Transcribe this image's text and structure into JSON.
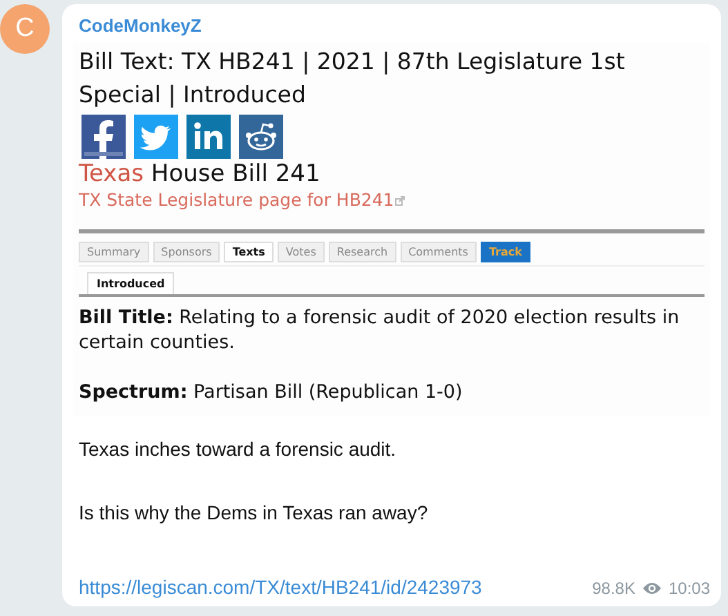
{
  "message": {
    "avatar_letter": "C",
    "sender": "CodeMonkeyZ",
    "preview": {
      "title": "Bill Text: TX HB241 | 2021 | 87th Legislature 1st Special | Introduced",
      "share_icons": [
        {
          "kind": "facebook"
        },
        {
          "kind": "twitter"
        },
        {
          "kind": "linkedin"
        },
        {
          "kind": "reddit"
        }
      ],
      "bill_state": "Texas",
      "bill_name": "House Bill 241",
      "state_link": "TX State Legislature page for HB241",
      "tabs": [
        {
          "label": "Summary",
          "kind": "tab",
          "selected": false
        },
        {
          "label": "Sponsors",
          "kind": "tab",
          "selected": false
        },
        {
          "label": "Texts",
          "kind": "tab",
          "selected": true
        },
        {
          "label": "Votes",
          "kind": "tab",
          "selected": false
        },
        {
          "label": "Research",
          "kind": "tab",
          "selected": false
        },
        {
          "label": "Comments",
          "kind": "tab",
          "selected": false
        },
        {
          "label": "Track",
          "kind": "action",
          "selected": false
        }
      ],
      "subtabs": [
        {
          "label": "Introduced",
          "selected": true
        }
      ],
      "bill_title": "**Bill Title:** Relating to a forensic audit of 2020 election results in certain counties.",
      "spectrum": "**Spectrum:** Partisan Bill (Republican 1-0)"
    },
    "paragraphs": [
      "Texas inches toward a forensic audit.",
      "Is this why the Dems in Texas ran away?"
    ],
    "link": "https://legiscan.com/TX/text/HB241/id/2423973",
    "views": "98.8K",
    "time": "10:03"
  }
}
